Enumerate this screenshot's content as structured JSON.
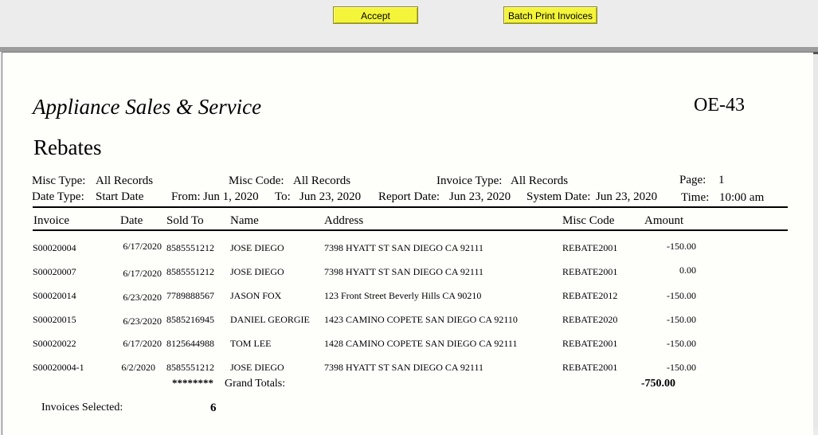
{
  "toolbar": {
    "accept_label": "Accept",
    "batch_label": "Batch Print Invoices"
  },
  "report": {
    "company": "Appliance Sales & Service",
    "code": "OE-43",
    "title": "Rebates",
    "misc_type_label": "Misc Type:",
    "misc_type_value": "All Records",
    "misc_code_label": "Misc Code:",
    "misc_code_value": "All Records",
    "invoice_type_label": "Invoice Type:",
    "invoice_type_value": "All Records",
    "page_label": "Page:",
    "page_value": "1",
    "date_type_label": "Date Type:",
    "date_type_value": "Start Date",
    "from_label": "From:",
    "from_value": "Jun 1, 2020",
    "to_label": "To:",
    "to_value": "Jun 23, 2020",
    "report_date_label": "Report Date:",
    "report_date_value": "Jun 23, 2020",
    "system_date_label": "System Date:",
    "system_date_value": "Jun 23, 2020",
    "time_label": "Time:",
    "time_value": "10:00 am"
  },
  "columns": {
    "invoice": "Invoice",
    "date": "Date",
    "sold_to": "Sold To",
    "name": "Name",
    "address": "Address",
    "misc_code": "Misc Code",
    "amount": "Amount"
  },
  "rows": [
    {
      "invoice": "S00020004",
      "date": "6/17/2020",
      "sold_to": "8585551212",
      "name": "JOSE DIEGO",
      "address": "7398 HYATT ST  SAN DIEGO CA 92111",
      "misc_code": "REBATE2001",
      "amount": "-150.00"
    },
    {
      "invoice": "S00020007",
      "date": "6/17/2020",
      "sold_to": "8585551212",
      "name": "JOSE DIEGO",
      "address": "7398 HYATT ST  SAN DIEGO CA 92111",
      "misc_code": "REBATE2001",
      "amount": "0.00"
    },
    {
      "invoice": "S00020014",
      "date": "6/23/2020",
      "sold_to": "7789888567",
      "name": "JASON FOX",
      "address": "123 Front Street  Beverly Hills CA 90210",
      "misc_code": "REBATE2012",
      "amount": "-150.00"
    },
    {
      "invoice": "S00020015",
      "date": "6/23/2020",
      "sold_to": "8585216945",
      "name": "DANIEL GEORGIE",
      "address": "1423 CAMINO COPETE  SAN DIEGO CA 92110",
      "misc_code": "REBATE2020",
      "amount": "-150.00"
    },
    {
      "invoice": "S00020022",
      "date": "6/17/2020",
      "sold_to": "8125644988",
      "name": "TOM LEE",
      "address": "1428 CAMINO COPETE  SAN DIEGO CA 92111",
      "misc_code": "REBATE2001",
      "amount": "-150.00"
    },
    {
      "invoice": "S00020004-1",
      "date": "6/2/2020",
      "sold_to": "8585551212",
      "name": "JOSE DIEGO",
      "address": "7398 HYATT ST  SAN DIEGO CA 92111",
      "misc_code": "REBATE2001",
      "amount": "-150.00"
    }
  ],
  "totals": {
    "stars": "********",
    "label": "Grand Totals:",
    "amount": "-750.00"
  },
  "footer": {
    "selected_label": "Invoices Selected:",
    "selected_value": "6"
  }
}
